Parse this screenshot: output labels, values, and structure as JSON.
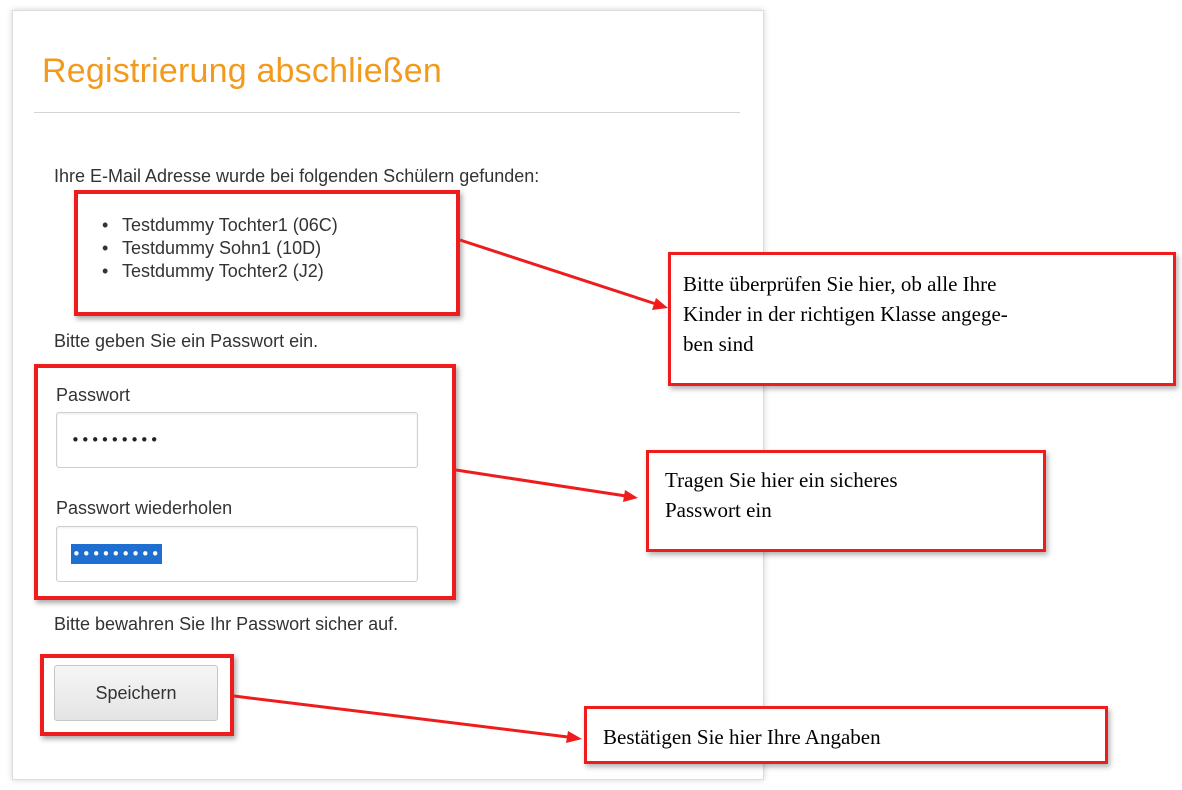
{
  "form": {
    "title": "Registrierung abschließen",
    "found_text": "Ihre E-Mail Adresse wurde bei folgenden Schülern gefunden:",
    "students": [
      "Testdummy Tochter1 (06C)",
      "Testdummy Sohn1 (10D)",
      "Testdummy Tochter2 (J2)"
    ],
    "password_prompt": "Bitte geben Sie ein Passwort ein.",
    "password_label": "Passwort",
    "password_value": "•••••••••",
    "password_repeat_label": "Passwort wiederholen",
    "password_repeat_value": "•••••••••",
    "keep_safe_text": "Bitte bewahren Sie Ihr Passwort sicher auf.",
    "save_label": "Speichern"
  },
  "callouts": {
    "students_check": [
      "Bitte überprüfen Sie hier, ob alle Ihre",
      "Kinder in der richtigen Klasse angege-",
      "ben sind"
    ],
    "password_hint": [
      "Tragen Sie hier ein sicheres",
      "Passwort ein"
    ],
    "confirm_hint": "Bestätigen Sie hier Ihre Angaben"
  },
  "colors": {
    "title": "#f39a1c",
    "annotation": "#ee1c1c",
    "selection": "#1f6fd1"
  }
}
